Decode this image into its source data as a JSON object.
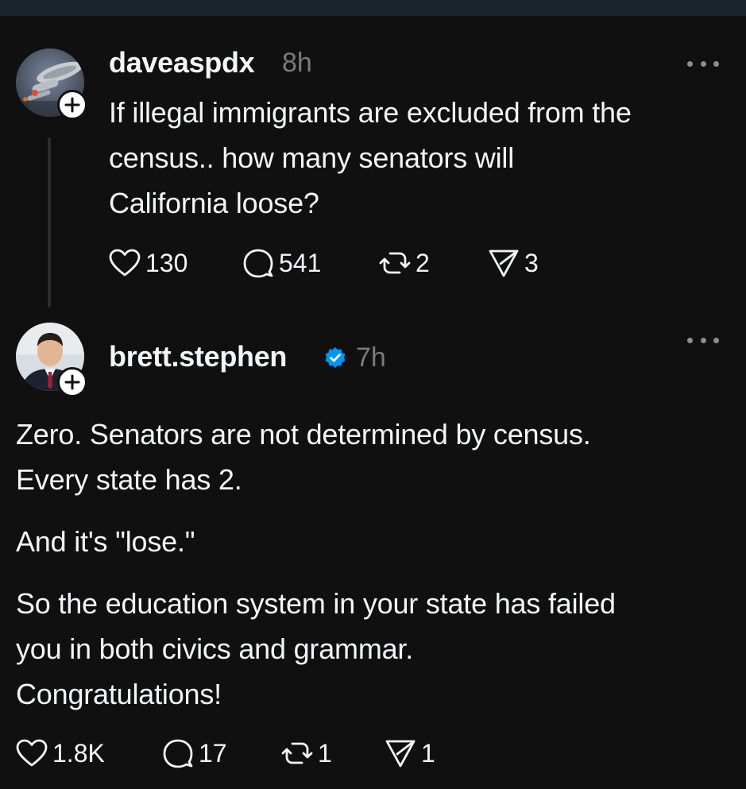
{
  "post": {
    "username": "daveaspdx",
    "time": "8h",
    "text_lines": [
      "If illegal immigrants are excluded from the",
      "census.. how many senators will",
      "California loose?"
    ],
    "stats": {
      "likes": "130",
      "replies": "541",
      "reposts": "2",
      "shares": "3"
    }
  },
  "reply": {
    "username": "brett.stephen",
    "verified": true,
    "time": "7h",
    "paragraphs": [
      [
        "Zero.  Senators are not determined by census.",
        "Every state has 2."
      ],
      [
        "And it's \"lose.\""
      ],
      [
        "So the education system in your state has failed",
        "you in both civics and grammar.",
        "Congratulations!"
      ]
    ],
    "stats": {
      "likes": "1.8K",
      "replies": "17",
      "reposts": "1",
      "shares": "1"
    }
  },
  "icons": {
    "like": "heart-icon",
    "reply": "comment-icon",
    "repost": "repost-icon",
    "share": "send-icon",
    "more": "more-icon",
    "follow": "plus-icon",
    "verified": "verified-badge-icon"
  },
  "colors": {
    "background": "#101010",
    "text": "#f3f5f7",
    "muted": "#7a7a7a",
    "verified": "#0095f6"
  }
}
